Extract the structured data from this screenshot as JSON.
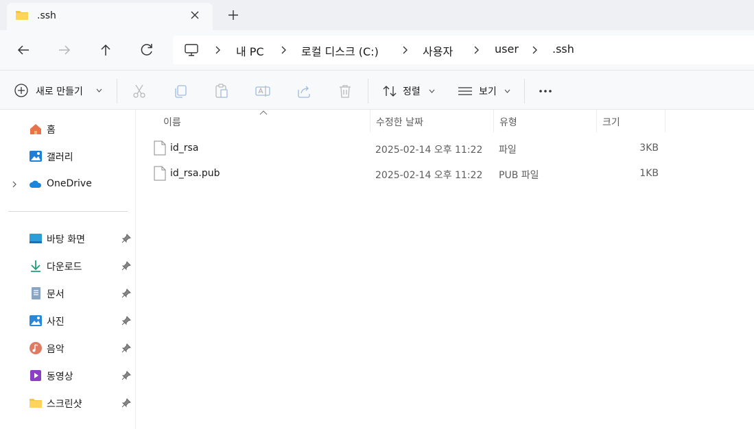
{
  "tab": {
    "title": ".ssh"
  },
  "address": {
    "crumbs": [
      "내 PC",
      "로컬 디스크 (C:)",
      "사용자",
      "user",
      ".ssh"
    ]
  },
  "commands": {
    "new": "새로 만들기",
    "sort": "정렬",
    "view": "보기"
  },
  "sidebar": {
    "home": "홈",
    "gallery": "갤러리",
    "onedrive": "OneDrive",
    "pinned": [
      "바탕 화면",
      "다운로드",
      "문서",
      "사진",
      "음악",
      "동영상",
      "스크린샷"
    ]
  },
  "columns": [
    "이름",
    "수정한 날짜",
    "유형",
    "크기"
  ],
  "files": [
    {
      "name": "id_rsa",
      "modified": "2025-02-14 오후 11:22",
      "type": "파일",
      "size": "3KB"
    },
    {
      "name": "id_rsa.pub",
      "modified": "2025-02-14 오후 11:22",
      "type": "PUB 파일",
      "size": "1KB"
    }
  ],
  "colors": {
    "accent": "#0067c0",
    "folder": "#f4c542",
    "background": "#f8f9fb"
  }
}
